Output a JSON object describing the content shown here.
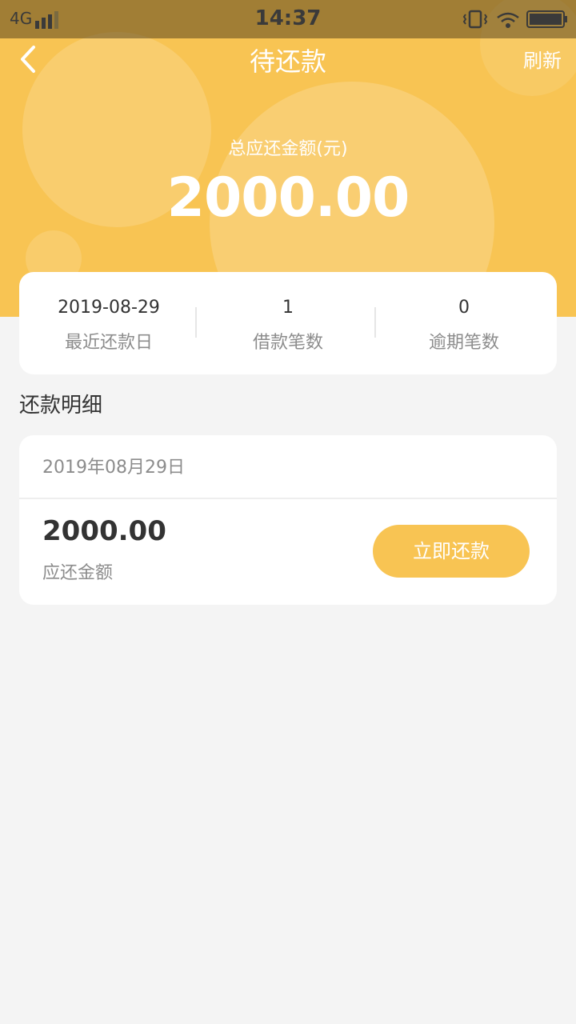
{
  "status_bar": {
    "network": "4G",
    "time": "14:37"
  },
  "nav": {
    "title": "待还款",
    "refresh_label": "刷新"
  },
  "total": {
    "label": "总应还金额(元)",
    "amount": "2000.00"
  },
  "summary": {
    "items": [
      {
        "value": "2019-08-29",
        "label": "最近还款日"
      },
      {
        "value": "1",
        "label": "借款笔数"
      },
      {
        "value": "0",
        "label": "逾期笔数"
      }
    ]
  },
  "details": {
    "section_title": "还款明细",
    "date": "2019年08月29日",
    "amount": "2000.00",
    "amount_label": "应还金额",
    "repay_button_label": "立即还款"
  },
  "colors": {
    "accent": "#f8c453",
    "background": "#f4f4f4"
  }
}
